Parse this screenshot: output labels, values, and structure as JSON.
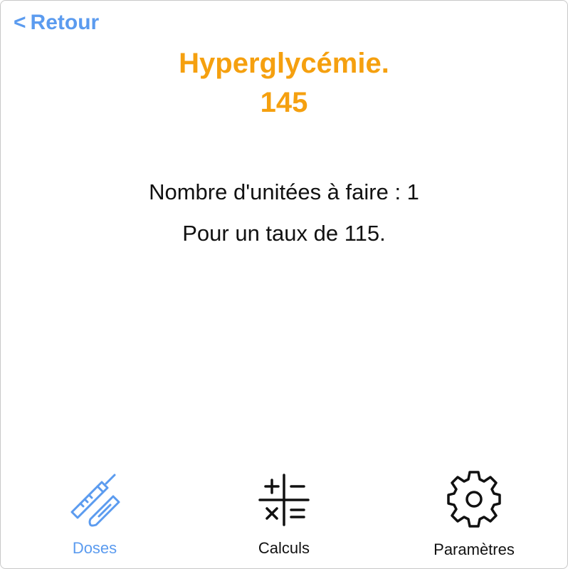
{
  "nav": {
    "back_chevron": "<",
    "back_label": "Retour"
  },
  "header": {
    "title": "Hyperglycémie.",
    "value": "145"
  },
  "result": {
    "units_line": "Nombre d'unitées à faire : 1",
    "rate_line": "Pour un taux de 115."
  },
  "tabbar": {
    "doses": {
      "label": "Doses",
      "icon": "insulin-pen-icon",
      "selected": true
    },
    "calculs": {
      "label": "Calculs",
      "icon": "calculator-symbols-icon",
      "selected": false
    },
    "parametres": {
      "label": "Paramètres",
      "icon": "gear-icon",
      "selected": false
    }
  },
  "colors": {
    "accent_blue": "#5b9bef",
    "title_orange": "#f5a00f",
    "text": "#111111"
  }
}
